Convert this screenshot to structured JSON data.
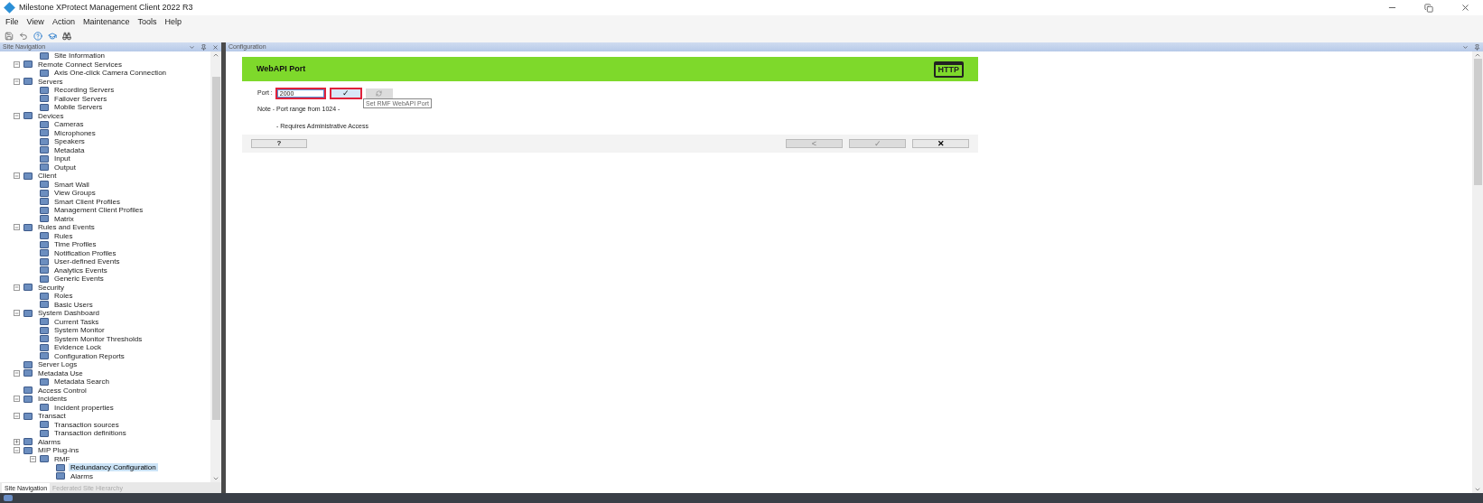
{
  "window": {
    "title": "Milestone XProtect Management Client 2022 R3"
  },
  "menu": [
    "File",
    "View",
    "Action",
    "Maintenance",
    "Tools",
    "Help"
  ],
  "site_navigation": {
    "title": "Site Navigation",
    "orphan_children": [
      {
        "label": "Site Information",
        "selected": false
      }
    ],
    "items": [
      {
        "label": "Remote Connect Services",
        "expanded": true,
        "selected": false,
        "children": [
          {
            "label": "Axis One-click Camera Connection",
            "selected": false
          }
        ]
      },
      {
        "label": "Servers",
        "expanded": true,
        "selected": false,
        "children": [
          {
            "label": "Recording Servers",
            "selected": false
          },
          {
            "label": "Failover Servers",
            "selected": false
          },
          {
            "label": "Mobile Servers",
            "selected": false
          }
        ]
      },
      {
        "label": "Devices",
        "expanded": true,
        "selected": false,
        "children": [
          {
            "label": "Cameras",
            "selected": false
          },
          {
            "label": "Microphones",
            "selected": false
          },
          {
            "label": "Speakers",
            "selected": false
          },
          {
            "label": "Metadata",
            "selected": false
          },
          {
            "label": "Input",
            "selected": false
          },
          {
            "label": "Output",
            "selected": false
          }
        ]
      },
      {
        "label": "Client",
        "expanded": true,
        "selected": false,
        "children": [
          {
            "label": "Smart Wall",
            "selected": false
          },
          {
            "label": "View Groups",
            "selected": false
          },
          {
            "label": "Smart Client Profiles",
            "selected": false
          },
          {
            "label": "Management Client Profiles",
            "selected": false
          },
          {
            "label": "Matrix",
            "selected": false
          }
        ]
      },
      {
        "label": "Rules and Events",
        "expanded": true,
        "selected": false,
        "children": [
          {
            "label": "Rules",
            "selected": false
          },
          {
            "label": "Time Profiles",
            "selected": false
          },
          {
            "label": "Notification Profiles",
            "selected": false
          },
          {
            "label": "User-defined Events",
            "selected": false
          },
          {
            "label": "Analytics Events",
            "selected": false
          },
          {
            "label": "Generic Events",
            "selected": false
          }
        ]
      },
      {
        "label": "Security",
        "expanded": true,
        "selected": false,
        "children": [
          {
            "label": "Roles",
            "selected": false
          },
          {
            "label": "Basic Users",
            "selected": false
          }
        ]
      },
      {
        "label": "System Dashboard",
        "expanded": true,
        "selected": false,
        "children": [
          {
            "label": "Current Tasks",
            "selected": false
          },
          {
            "label": "System Monitor",
            "selected": false
          },
          {
            "label": "System Monitor Thresholds",
            "selected": false
          },
          {
            "label": "Evidence Lock",
            "selected": false
          },
          {
            "label": "Configuration Reports",
            "selected": false
          }
        ]
      },
      {
        "label": "Server Logs",
        "selected": false
      },
      {
        "label": "Metadata Use",
        "expanded": true,
        "selected": false,
        "children": [
          {
            "label": "Metadata Search",
            "selected": false
          }
        ]
      },
      {
        "label": "Access Control",
        "selected": false
      },
      {
        "label": "Incidents",
        "expanded": true,
        "selected": false,
        "children": [
          {
            "label": "Incident properties",
            "selected": false
          }
        ]
      },
      {
        "label": "Transact",
        "expanded": true,
        "selected": false,
        "children": [
          {
            "label": "Transaction sources",
            "selected": false
          },
          {
            "label": "Transaction definitions",
            "selected": false
          }
        ]
      },
      {
        "label": "Alarms",
        "expanded": false,
        "selected": false
      },
      {
        "label": "MIP Plug-ins",
        "expanded": true,
        "selected": false,
        "children": [
          {
            "label": "RMF",
            "expanded": true,
            "selected": false,
            "children": [
              {
                "label": "Redundancy Configuration",
                "selected": true
              },
              {
                "label": "Alarms",
                "selected": false
              }
            ]
          }
        ]
      }
    ],
    "tabs": [
      {
        "label": "Site Navigation",
        "selected": true
      },
      {
        "label": "Federated Site Hierarchy",
        "selected": false
      }
    ]
  },
  "configuration": {
    "title": "Configuration",
    "banner": {
      "title": "WebAPI Port",
      "logo_text": "HTTP"
    },
    "port": {
      "label": "Port :",
      "value": "2000",
      "set_button": "✓"
    },
    "tooltip": "Set RMF WebAPI Port",
    "notes": [
      "Note - Port range from 1024 -",
      "- Requires Administrative Access"
    ],
    "help_button": "?",
    "nav_buttons": [
      {
        "label": "<",
        "disabled": true
      },
      {
        "label": "✓",
        "disabled": true
      },
      {
        "label": "✕",
        "disabled": false
      }
    ]
  }
}
